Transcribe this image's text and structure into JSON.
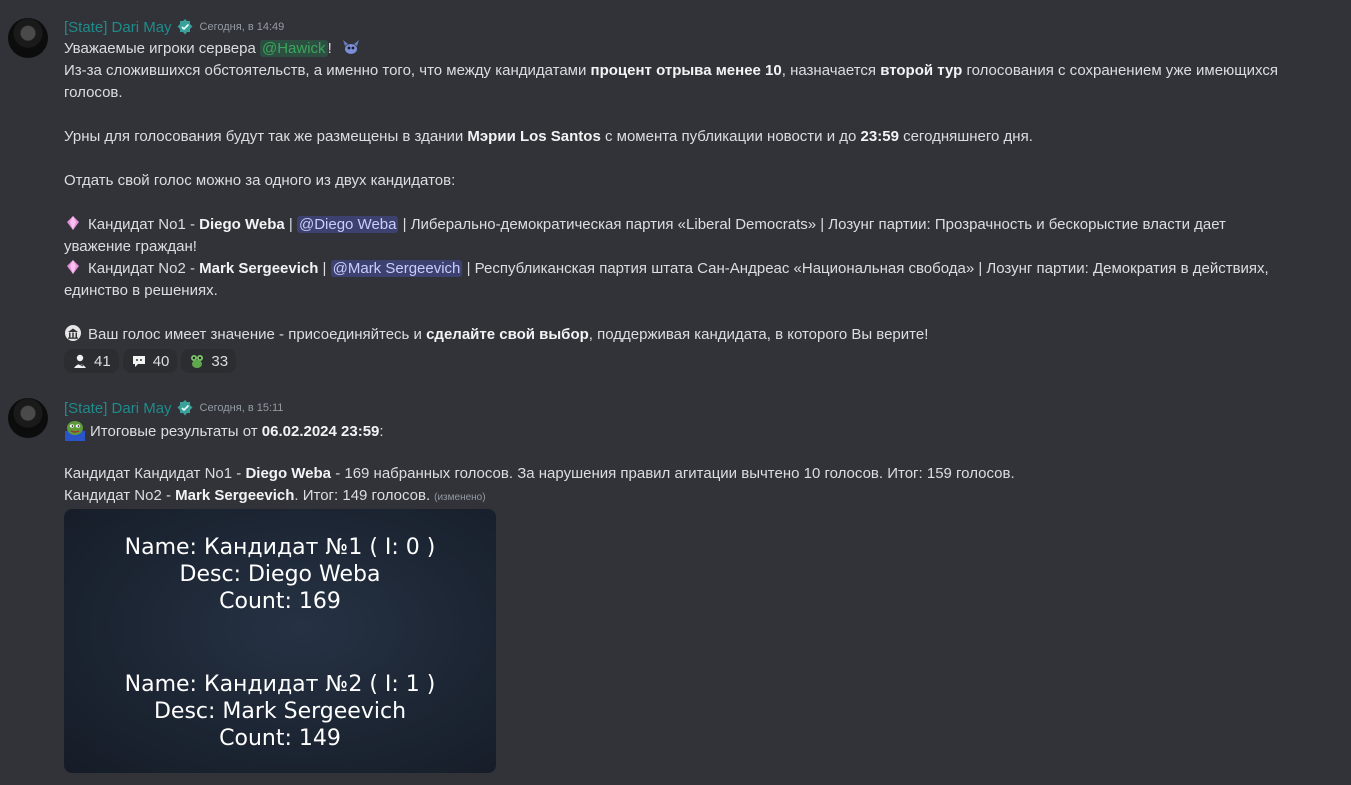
{
  "messages": [
    {
      "author": "[State] Dari May",
      "timestamp": "Сегодня, в 14:49",
      "greeting_prefix": "Уважаемые игроки сервера ",
      "greeting_mention": "@Hawick",
      "greeting_suffix": "!",
      "p1_a": "Из-за сложившихся обстоятельств, а именно того, что между кандидатами ",
      "p1_b": "процент отрыва менее 10",
      "p1_c": ", назначается ",
      "p1_d": "второй тур",
      "p1_e": " голосования с сохранением уже имеющихся",
      "p1_f": "голосов.",
      "p2_a": "Урны для голосования будут так же размещены в здании ",
      "p2_b": "Мэрии Los Santos",
      "p2_c": " с момента публикации новости и до ",
      "p2_d": "23:59",
      "p2_e": " сегодняшнего дня.",
      "p3": "Отдать свой голос можно за одного из двух кандидатов:",
      "c1_a": "Кандидат No1 -  ",
      "c1_name": "Diego Weba",
      "c1_sep": " | ",
      "c1_mention": "@Diego Weba",
      "c1_rest": " | Либерально-демократическая партия «Liberal Democrats» | Лозунг партии: Прозрачность и бескорыстие власти дает",
      "c1_line2": "уважение граждан!",
      "c2_a": "Кандидат No2 - ",
      "c2_name": "Mark Sergeevich",
      "c2_sep": " | ",
      "c2_mention": "@Mark Sergeevich",
      "c2_rest": " | Республиканская партия штата Сан-Андреас «Национальная свобода»  | Лозунг партии: Демократия в действиях,",
      "c2_line2": "единство в решениях.",
      "p4_a": "Ваш голос имеет значение - присоединяйтесь и ",
      "p4_b": "сделайте свой выбор",
      "p4_c": ", поддерживая кандидата, в которого Вы верите!",
      "reactions": [
        {
          "icon": "person-emoji",
          "count": "41"
        },
        {
          "icon": "chat-bubble-emoji",
          "count": "40"
        },
        {
          "icon": "frog-emoji",
          "count": "33"
        }
      ]
    },
    {
      "author": "[State] Dari May",
      "timestamp": "Сегодня, в 15:11",
      "r_a": "Итоговые результаты от ",
      "r_b": "06.02.2024 23:59",
      "r_c": ":",
      "r1_a": "Кандидат Кандидат No1 -  ",
      "r1_name": "Diego Weba",
      "r1_rest": " - 169 набранных голосов.  За нарушения правил агитации вычтено 10 голосов. Итог: 159 голосов.",
      "r2_a": "Кандидат No2 - ",
      "r2_name": "Mark Sergeevich",
      "r2_rest": ". Итог: 149 голосов.",
      "edited": "(изменено)",
      "image": {
        "l1": "Name: Кандидат №1 ( I: 0 )",
        "l2": "Desc: Diego Weba",
        "l3": "Count: 169",
        "l4": "Name: Кандидат №2 ( I: 1 )",
        "l5": "Desc: Mark Sergeevich",
        "l6": "Count: 149"
      }
    }
  ],
  "colors": {
    "background": "#313338",
    "author": "#1f8b8b",
    "mention_bg": "#3c4270",
    "green_mention": "#3ba55c"
  }
}
